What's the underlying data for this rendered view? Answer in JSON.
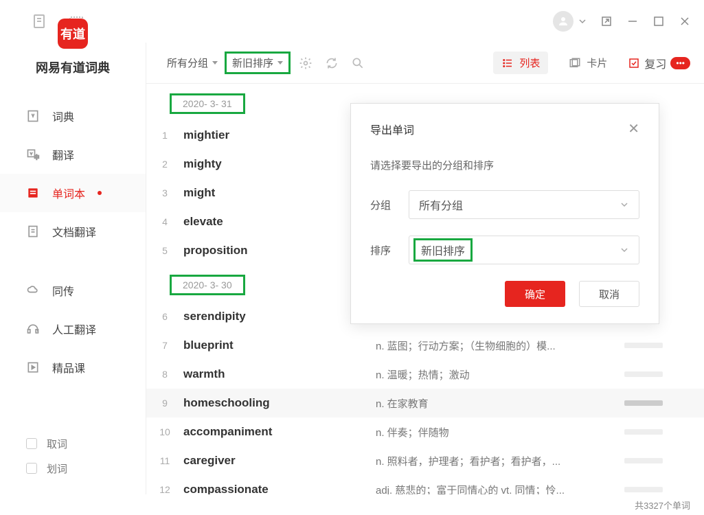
{
  "brand": {
    "logo_text": "有道",
    "title": "网易有道词典"
  },
  "sidebar": {
    "items": [
      {
        "label": "词典"
      },
      {
        "label": "翻译"
      },
      {
        "label": "单词本"
      },
      {
        "label": "文档翻译"
      },
      {
        "label": "同传"
      },
      {
        "label": "人工翻译"
      },
      {
        "label": "精品课"
      }
    ],
    "bottom": [
      {
        "label": "取词"
      },
      {
        "label": "划词"
      }
    ]
  },
  "toolbar": {
    "group_filter": "所有分组",
    "sort": "新旧排序",
    "view_list": "列表",
    "view_card": "卡片",
    "review": "复习",
    "review_badge": "•••"
  },
  "dates": {
    "d1": "2020- 3- 31",
    "d2": "2020- 3- 30"
  },
  "words": [
    {
      "n": "1",
      "w": "mightier",
      "d": ""
    },
    {
      "n": "2",
      "w": "mighty",
      "d": ""
    },
    {
      "n": "3",
      "w": "might",
      "d": ""
    },
    {
      "n": "4",
      "w": "elevate",
      "d": ""
    },
    {
      "n": "5",
      "w": "proposition",
      "d": ""
    },
    {
      "n": "6",
      "w": "serendipity",
      "d": ""
    },
    {
      "n": "7",
      "w": "blueprint",
      "d": "n. 蓝图；行动方案；（生物细胞的）模..."
    },
    {
      "n": "8",
      "w": "warmth",
      "d": "n. 温暖；热情；激动"
    },
    {
      "n": "9",
      "w": "homeschooling",
      "d": "n. 在家教育"
    },
    {
      "n": "10",
      "w": "accompaniment",
      "d": "n. 伴奏；伴随物"
    },
    {
      "n": "11",
      "w": "caregiver",
      "d": "n. 照料者，护理者；看护者；看护者，..."
    },
    {
      "n": "12",
      "w": "compassionate",
      "d": "adj. 慈悲的；富于同情心的 vt. 同情；怜..."
    }
  ],
  "footer": {
    "count": "共3327个单词"
  },
  "modal": {
    "title": "导出单词",
    "subtitle": "请选择要导出的分组和排序",
    "group_label": "分组",
    "group_value": "所有分组",
    "sort_label": "排序",
    "sort_value": "新旧排序",
    "ok": "确定",
    "cancel": "取消"
  }
}
